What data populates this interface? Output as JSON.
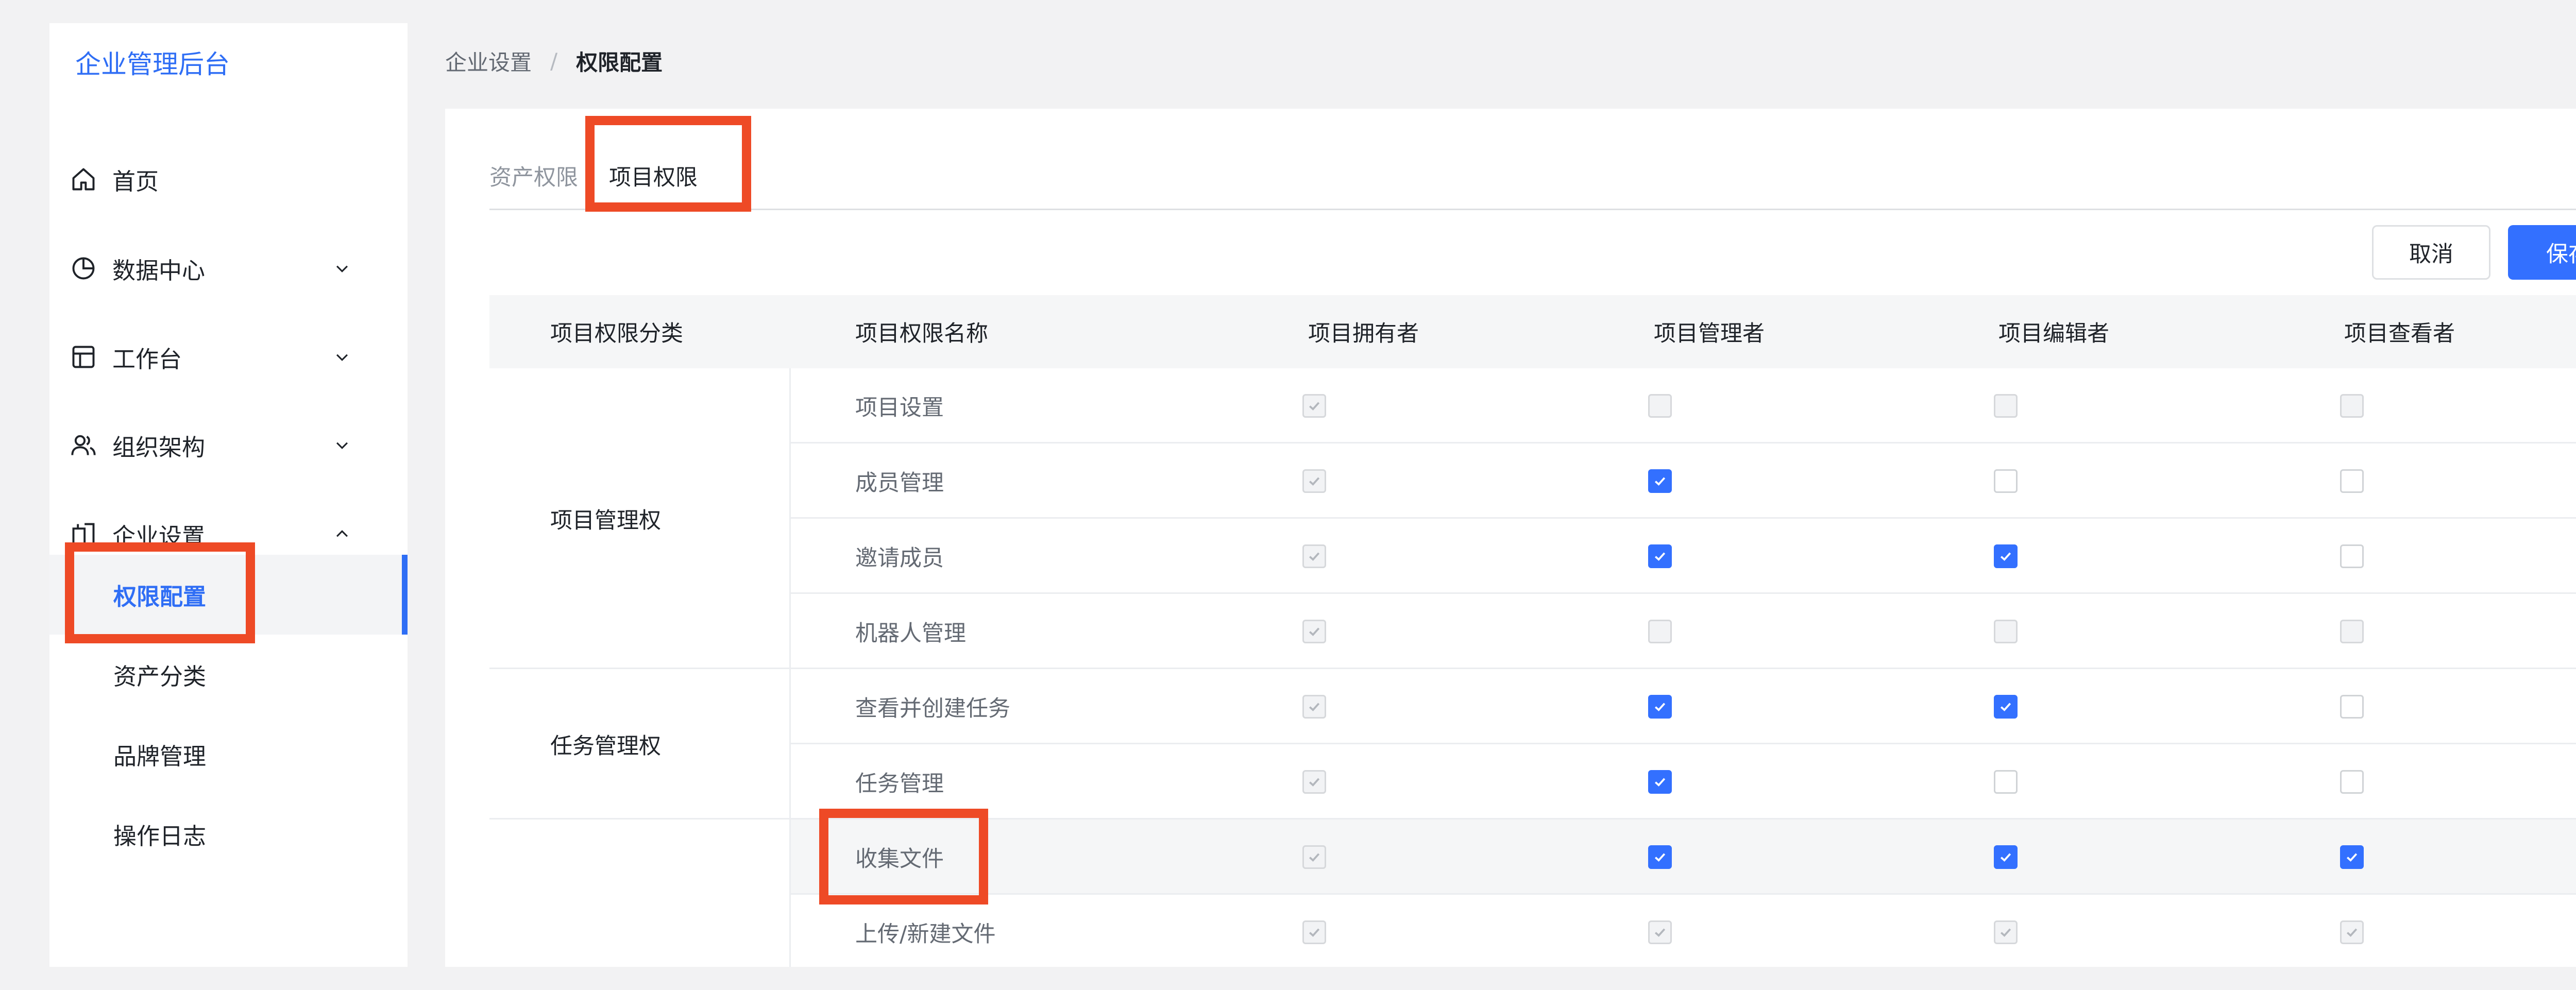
{
  "app": {
    "title": "企业管理后台"
  },
  "sidebar": {
    "menu": [
      {
        "label": "首页",
        "icon": "home-icon",
        "chevron": ""
      },
      {
        "label": "数据中心",
        "icon": "pie-chart-icon",
        "chevron": "down"
      },
      {
        "label": "工作台",
        "icon": "layout-icon",
        "chevron": "down"
      },
      {
        "label": "组织架构",
        "icon": "users-icon",
        "chevron": "down"
      },
      {
        "label": "企业设置",
        "icon": "building-icon",
        "chevron": "up"
      }
    ],
    "submenu": [
      {
        "label": "权限配置",
        "active": true
      },
      {
        "label": "资产分类",
        "active": false
      },
      {
        "label": "品牌管理",
        "active": false
      },
      {
        "label": "操作日志",
        "active": false
      }
    ]
  },
  "breadcrumb": {
    "parent": "企业设置",
    "separator": "/",
    "current": "权限配置"
  },
  "tabs": [
    {
      "label": "资产权限",
      "active": false
    },
    {
      "label": "项目权限",
      "active": true
    }
  ],
  "actions": {
    "cancel": "取消",
    "save": "保存"
  },
  "table": {
    "headers": [
      "项目权限分类",
      "项目权限名称",
      "项目拥有者",
      "项目管理者",
      "项目编辑者",
      "项目查看者"
    ],
    "categories": [
      {
        "label": "项目管理权",
        "rows": 4
      },
      {
        "label": "任务管理权",
        "rows": 2
      },
      {
        "label": "",
        "rows": 2
      }
    ],
    "rows": [
      {
        "name": "项目设置",
        "perms": [
          "disabled-checked",
          "disabled-unchecked",
          "disabled-unchecked",
          "disabled-unchecked"
        ]
      },
      {
        "name": "成员管理",
        "perms": [
          "disabled-checked",
          "checked",
          "unchecked",
          "unchecked"
        ]
      },
      {
        "name": "邀请成员",
        "perms": [
          "disabled-checked",
          "checked",
          "checked",
          "unchecked"
        ]
      },
      {
        "name": "机器人管理",
        "perms": [
          "disabled-checked",
          "disabled-unchecked",
          "disabled-unchecked",
          "disabled-unchecked"
        ]
      },
      {
        "name": "查看并创建任务",
        "perms": [
          "disabled-checked",
          "checked",
          "checked",
          "unchecked"
        ]
      },
      {
        "name": "任务管理",
        "perms": [
          "disabled-checked",
          "checked",
          "unchecked",
          "unchecked"
        ]
      },
      {
        "name": "收集文件",
        "perms": [
          "disabled-checked",
          "checked",
          "checked",
          "checked"
        ],
        "hovered": true
      },
      {
        "name": "上传/新建文件",
        "perms": [
          "disabled-checked",
          "disabled-checked",
          "disabled-checked",
          "disabled-checked"
        ]
      }
    ]
  },
  "colors": {
    "accent": "#3370ff",
    "highlight": "#ee4a26",
    "logo": "#2f6ef5"
  }
}
